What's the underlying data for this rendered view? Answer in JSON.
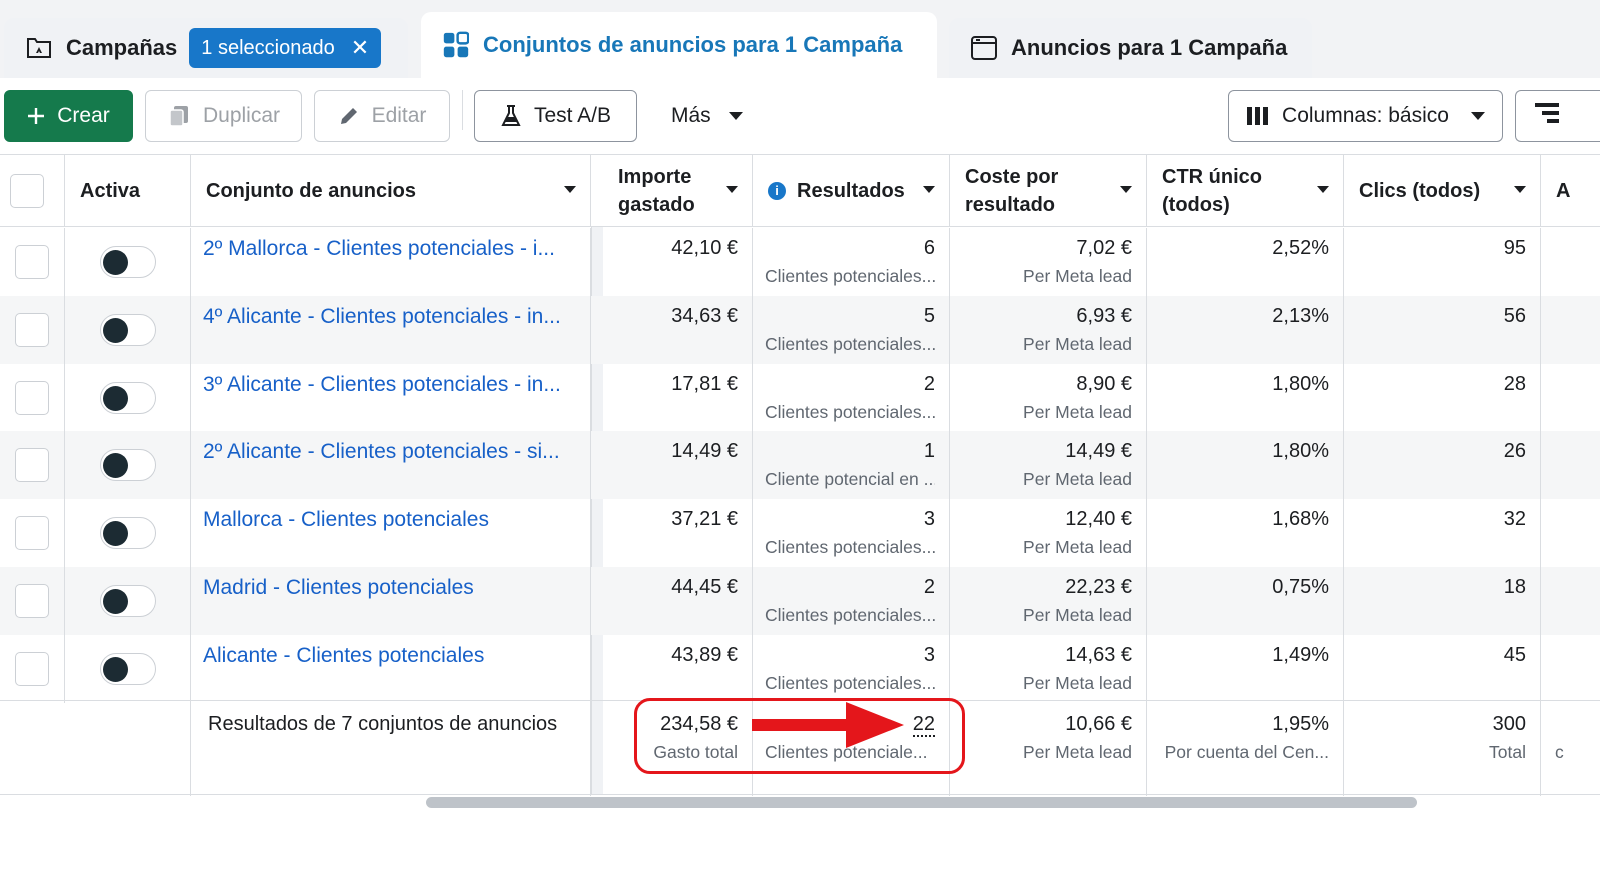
{
  "tabs": {
    "campaigns": {
      "label": "Campañas",
      "badge": "1 seleccionado"
    },
    "adsets": {
      "label": "Conjuntos de anuncios para 1 Campaña"
    },
    "ads": {
      "label": "Anuncios para 1 Campaña"
    }
  },
  "toolbar": {
    "create": "Crear",
    "duplicate": "Duplicar",
    "edit": "Editar",
    "ab_test": "Test A/B",
    "more": "Más",
    "columns": "Columnas: básico"
  },
  "table": {
    "headers": {
      "active": "Activa",
      "name": "Conjunto de anuncios",
      "spend": "Importe gastado",
      "results": "Resultados",
      "cost": "Coste por resultado",
      "ctr": "CTR único (todos)",
      "clicks": "Clics (todos)",
      "next": "A"
    },
    "rows": [
      {
        "name": "2º Mallorca - Clientes potenciales - i...",
        "spend": "42,10 €",
        "results": "6",
        "results_sub": "Clientes potenciales...",
        "cost": "7,02 €",
        "cost_sub": "Per Meta lead",
        "ctr": "2,52%",
        "clicks": "95"
      },
      {
        "name": "4º Alicante - Clientes potenciales - in...",
        "spend": "34,63 €",
        "results": "5",
        "results_sub": "Clientes potenciales...",
        "cost": "6,93 €",
        "cost_sub": "Per Meta lead",
        "ctr": "2,13%",
        "clicks": "56"
      },
      {
        "name": "3º Alicante - Clientes potenciales - in...",
        "spend": "17,81 €",
        "results": "2",
        "results_sub": "Clientes potenciales...",
        "cost": "8,90 €",
        "cost_sub": "Per Meta lead",
        "ctr": "1,80%",
        "clicks": "28"
      },
      {
        "name": "2º Alicante - Clientes potenciales - si...",
        "spend": "14,49 €",
        "results": "1",
        "results_sub": "Cliente potencial en ...",
        "cost": "14,49 €",
        "cost_sub": "Per Meta lead",
        "ctr": "1,80%",
        "clicks": "26"
      },
      {
        "name": "Mallorca - Clientes potenciales",
        "spend": "37,21 €",
        "results": "3",
        "results_sub": "Clientes potenciales...",
        "cost": "12,40 €",
        "cost_sub": "Per Meta lead",
        "ctr": "1,68%",
        "clicks": "32"
      },
      {
        "name": "Madrid - Clientes potenciales",
        "spend": "44,45 €",
        "results": "2",
        "results_sub": "Clientes potenciales...",
        "cost": "22,23 €",
        "cost_sub": "Per Meta lead",
        "ctr": "0,75%",
        "clicks": "18"
      },
      {
        "name": "Alicante - Clientes potenciales",
        "spend": "43,89 €",
        "results": "3",
        "results_sub": "Clientes potenciales...",
        "cost": "14,63 €",
        "cost_sub": "Per Meta lead",
        "ctr": "1,49%",
        "clicks": "45"
      }
    ],
    "totals": {
      "label": "Resultados de 7 conjuntos de anuncios",
      "spend": "234,58 €",
      "spend_sub": "Gasto total",
      "results": "22",
      "results_sub": "Clientes potenciale...",
      "cost": "10,66 €",
      "cost_sub": "Per Meta lead",
      "ctr": "1,95%",
      "ctr_sub": "Por cuenta del Cen...",
      "clicks": "300",
      "clicks_sub": "Total",
      "next_sub": "c"
    }
  },
  "colors": {
    "accent_blue": "#1877c9",
    "create_green": "#157a4c",
    "annotation_red": "#e4161b"
  }
}
